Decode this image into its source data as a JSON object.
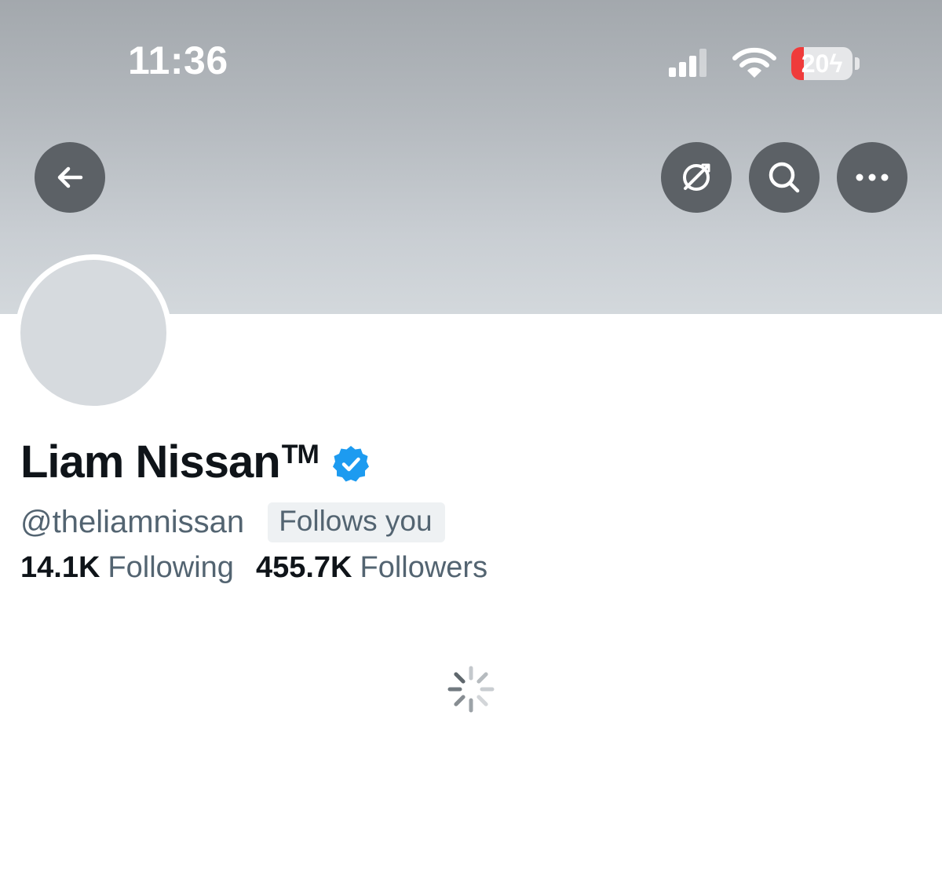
{
  "status_bar": {
    "time": "11:36",
    "battery_level": "20",
    "battery_fraction": 0.2,
    "icons": [
      "signal-icon",
      "wifi-icon",
      "battery-charging-icon"
    ]
  },
  "header_actions": {
    "back": "back-arrow-icon",
    "translate": "translate-globe-icon",
    "search": "search-icon",
    "more": "more-dots-icon"
  },
  "profile": {
    "display_name": "Liam Nissan",
    "trademark": "TM",
    "handle": "@theliamnissan",
    "follows_you": "Follows you",
    "verified_color": "#1d9bf0",
    "following_count": "14.1K",
    "following_label": "Following",
    "followers_count": "455.7K",
    "followers_label": "Followers"
  },
  "loading": {
    "icon": "loading-spinner-icon"
  }
}
